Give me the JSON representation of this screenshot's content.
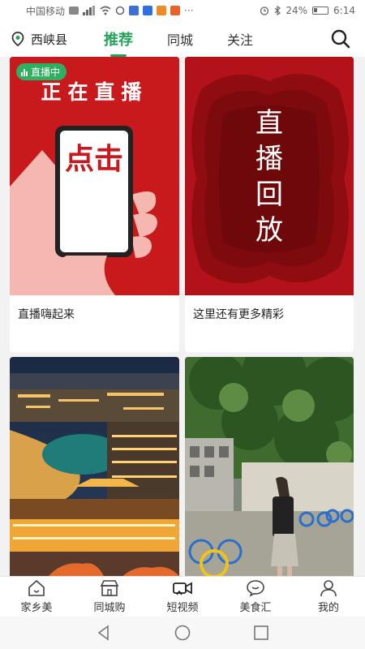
{
  "status_bar": {
    "carrier": "中国移动",
    "battery": "24%",
    "time": "6:14"
  },
  "top_nav": {
    "location": "西峡县",
    "tabs": [
      {
        "label": "推荐",
        "active": true
      },
      {
        "label": "同城",
        "active": false
      },
      {
        "label": "关注",
        "active": false
      }
    ],
    "accent_color": "#22a35a"
  },
  "feed": {
    "cards": [
      {
        "title": "直播嗨起来",
        "badge": "直播中",
        "poster_text_top": "正在直播",
        "phone_text": "点击"
      },
      {
        "title": "这里还有更多精彩",
        "poster_text": [
          "直",
          "播",
          "回",
          "放"
        ]
      },
      {
        "title": ""
      },
      {
        "title": ""
      }
    ]
  },
  "bottom_nav": {
    "items": [
      {
        "label": "家乡美",
        "icon": "home-icon"
      },
      {
        "label": "同城购",
        "icon": "shop-icon"
      },
      {
        "label": "短视频",
        "icon": "video-camera-icon"
      },
      {
        "label": "美食汇",
        "icon": "chat-bubble-icon"
      },
      {
        "label": "我的",
        "icon": "user-icon"
      }
    ]
  },
  "system_nav": {
    "icons": [
      "back-icon",
      "home-circle-icon",
      "recents-icon"
    ]
  }
}
